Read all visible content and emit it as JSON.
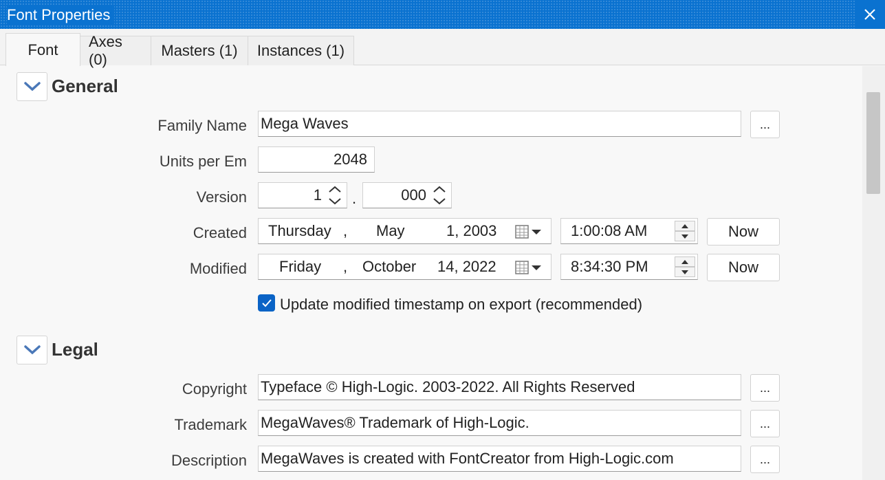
{
  "window": {
    "title": "Font Properties"
  },
  "tabs": [
    {
      "label": "Font"
    },
    {
      "label": "Axes (0)"
    },
    {
      "label": "Masters (1)"
    },
    {
      "label": "Instances (1)"
    }
  ],
  "general": {
    "title": "General",
    "family_name": {
      "label": "Family Name",
      "value": "Mega Waves",
      "button": "..."
    },
    "units_per_em": {
      "label": "Units per Em",
      "value": "2048"
    },
    "version": {
      "label": "Version",
      "major": "1",
      "separator": ".",
      "minor": "000"
    },
    "created": {
      "label": "Created",
      "weekday": "Thursday",
      "comma": ",",
      "month": "May",
      "day_year": "1, 2003",
      "time": "1:00:08 AM",
      "now_button": "Now"
    },
    "modified": {
      "label": "Modified",
      "weekday": "Friday",
      "comma": ",",
      "month": "October",
      "day_year": "14, 2022",
      "time": "8:34:30 PM",
      "now_button": "Now"
    },
    "update_timestamp": {
      "checked": true,
      "label": "Update modified timestamp on export (recommended)"
    }
  },
  "legal": {
    "title": "Legal",
    "copyright": {
      "label": "Copyright",
      "value": "Typeface © High-Logic. 2003-2022. All Rights Reserved",
      "button": "..."
    },
    "trademark": {
      "label": "Trademark",
      "value": "MegaWaves® Trademark of High-Logic.",
      "button": "..."
    },
    "description": {
      "label": "Description",
      "value": "MegaWaves is created with FontCreator from High-Logic.com",
      "button": "..."
    }
  },
  "colors": {
    "titlebar": "#0a72d0",
    "accent": "#0a63c6",
    "chevron": "#4a78b8"
  }
}
